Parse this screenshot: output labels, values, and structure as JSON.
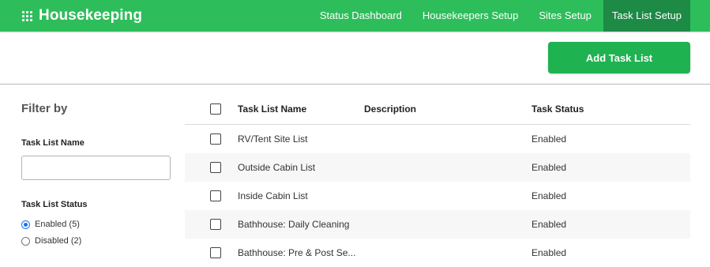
{
  "app": {
    "title": "Housekeeping"
  },
  "nav": [
    {
      "label": "Status Dashboard",
      "active": false
    },
    {
      "label": "Housekeepers Setup",
      "active": false
    },
    {
      "label": "Sites Setup",
      "active": false
    },
    {
      "label": "Task List Setup",
      "active": true
    }
  ],
  "toolbar": {
    "add_label": "Add Task List"
  },
  "filter": {
    "title": "Filter by",
    "name_label": "Task List Name",
    "name_value": "",
    "status_label": "Task List Status",
    "options": [
      {
        "label": "Enabled (5)",
        "checked": true
      },
      {
        "label": "Disabled (2)",
        "checked": false
      }
    ]
  },
  "table": {
    "headers": {
      "name": "Task List Name",
      "description": "Description",
      "status": "Task Status"
    },
    "rows": [
      {
        "name": "RV/Tent Site List",
        "description": "",
        "status": "Enabled"
      },
      {
        "name": "Outside Cabin List",
        "description": "",
        "status": "Enabled"
      },
      {
        "name": "Inside Cabin List",
        "description": "",
        "status": "Enabled"
      },
      {
        "name": "Bathhouse: Daily Cleaning",
        "description": "",
        "status": "Enabled"
      },
      {
        "name": "Bathhouse: Pre & Post Se...",
        "description": "",
        "status": "Enabled"
      }
    ]
  },
  "colors": {
    "header_green": "#2ebd5b",
    "active_tab": "#1d8a45",
    "button_green": "#1fb251",
    "radio_blue": "#1a73e8"
  },
  "icons": {
    "brand": "app-grid-icon"
  }
}
